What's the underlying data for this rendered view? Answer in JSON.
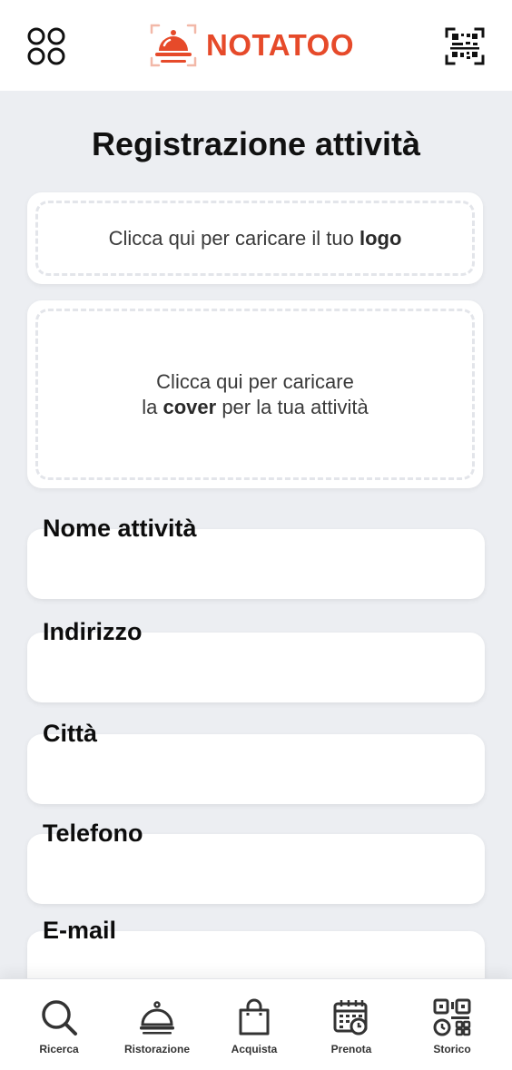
{
  "header": {
    "brand_name": "NOTATOO",
    "brand_color": "#e64a2a",
    "menu_icon": "grid-menu-icon",
    "qr_icon": "qr-scan-icon"
  },
  "page": {
    "title": "Registrazione attività"
  },
  "uploads": {
    "logo": {
      "prefix": "Clicca qui per caricare il tuo ",
      "bold": "logo"
    },
    "cover": {
      "line1": "Clicca qui per caricare",
      "line2_prefix": "la ",
      "line2_bold": "cover",
      "line2_suffix": " per la tua attività"
    }
  },
  "fields": [
    {
      "label": "Nome attività",
      "value": ""
    },
    {
      "label": "Indirizzo",
      "value": ""
    },
    {
      "label": "Città",
      "value": ""
    },
    {
      "label": "Telefono",
      "value": ""
    },
    {
      "label": "E-mail",
      "value": ""
    }
  ],
  "nav": [
    {
      "label": "Ricerca",
      "icon": "search-icon"
    },
    {
      "label": "Ristorazione",
      "icon": "cloche-icon"
    },
    {
      "label": "Acquista",
      "icon": "shopping-bag-icon"
    },
    {
      "label": "Prenota",
      "icon": "calendar-clock-icon"
    },
    {
      "label": "Storico",
      "icon": "qr-history-icon"
    }
  ],
  "colors": {
    "background": "#eceef2",
    "card": "#ffffff",
    "accent": "#e64a2a"
  }
}
